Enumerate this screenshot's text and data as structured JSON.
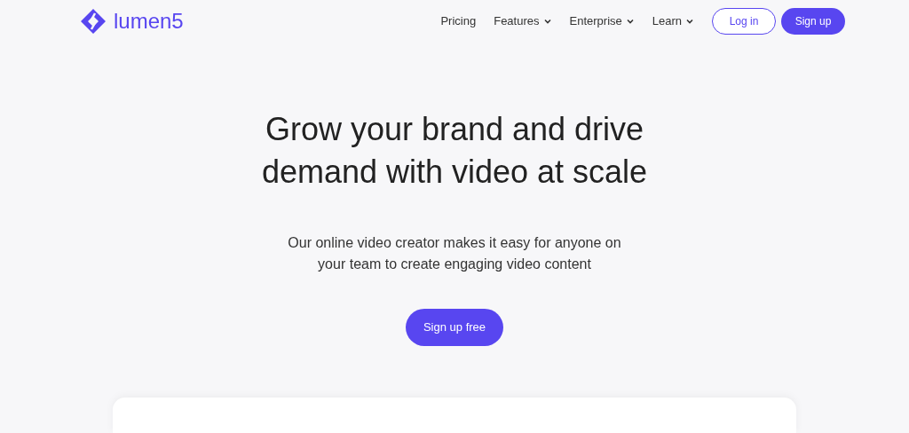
{
  "logo": {
    "text": "lumen5"
  },
  "nav": [
    {
      "label": "Pricing",
      "kind": "link"
    },
    {
      "label": "Features",
      "kind": "menu"
    },
    {
      "label": "Enterprise",
      "kind": "menu"
    },
    {
      "label": "Learn",
      "kind": "menu"
    }
  ],
  "auth_buttons": [
    {
      "label": "Log in",
      "kind": "outline"
    },
    {
      "label": "Sign up",
      "kind": "filled"
    }
  ],
  "hero": {
    "headline": "Grow your brand and drive demand with video at scale",
    "subtitle": "Our online video creator makes it easy for anyone on your team to create engaging video content",
    "cta": "Sign up free"
  }
}
